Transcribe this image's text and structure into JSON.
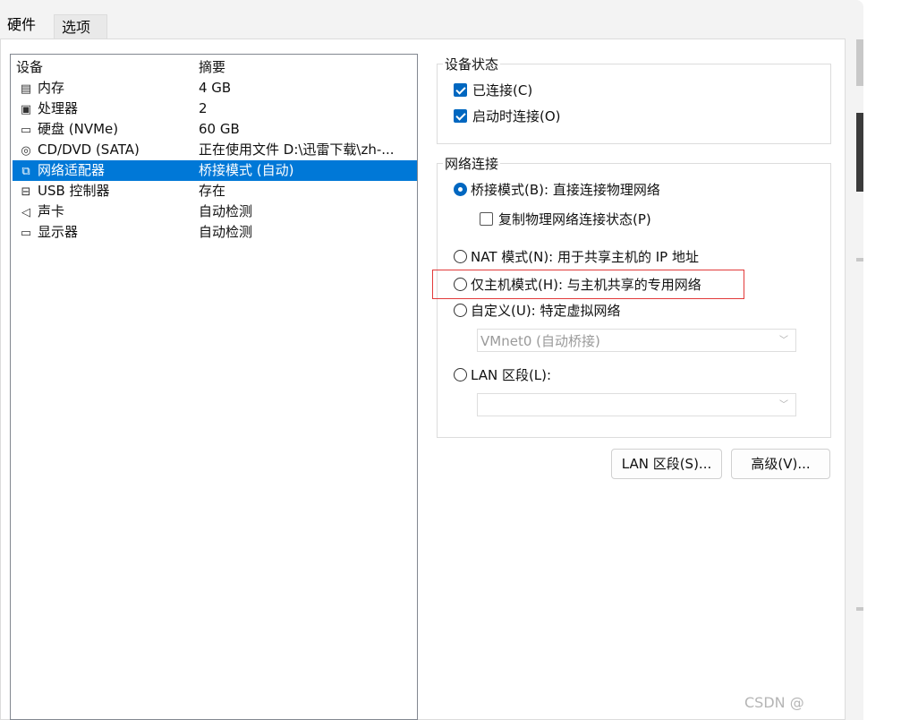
{
  "tabs": {
    "hardware": "硬件",
    "options": "选项"
  },
  "device_list": {
    "col_device": "设备",
    "col_summary": "摘要",
    "rows": [
      {
        "name": "内存",
        "summary": "4 GB",
        "icon": "memory-icon"
      },
      {
        "name": "处理器",
        "summary": "2",
        "icon": "cpu-icon"
      },
      {
        "name": "硬盘 (NVMe)",
        "summary": "60 GB",
        "icon": "hard-disk-icon"
      },
      {
        "name": "CD/DVD (SATA)",
        "summary": "正在使用文件 D:\\迅雷下载\\zh-...",
        "icon": "cd-dvd-icon"
      },
      {
        "name": "网络适配器",
        "summary": "桥接模式 (自动)",
        "icon": "network-adapter-icon",
        "selected": true
      },
      {
        "name": "USB 控制器",
        "summary": "存在",
        "icon": "usb-icon"
      },
      {
        "name": "声卡",
        "summary": "自动检测",
        "icon": "speaker-icon"
      },
      {
        "name": "显示器",
        "summary": "自动检测",
        "icon": "monitor-icon"
      }
    ]
  },
  "device_status": {
    "title": "设备状态",
    "connected": "已连接(C)",
    "connect_on_start": "启动时连接(O)"
  },
  "network": {
    "title": "网络连接",
    "bridged": "桥接模式(B): 直接连接物理网络",
    "replicate": "复制物理网络连接状态(P)",
    "nat": "NAT 模式(N): 用于共享主机的 IP 地址",
    "host_only": "仅主机模式(H): 与主机共享的专用网络",
    "custom": "自定义(U): 特定虚拟网络",
    "custom_select": "VMnet0 (自动桥接)",
    "lan_segment": "LAN 区段(L):",
    "lan_select": ""
  },
  "buttons": {
    "lan_segments": "LAN 区段(S)...",
    "advanced": "高级(V)..."
  },
  "watermark": "CSDN @",
  "colors": {
    "accent": "#0067c0",
    "selection": "#0078d7",
    "highlight": "#e23a3a"
  }
}
